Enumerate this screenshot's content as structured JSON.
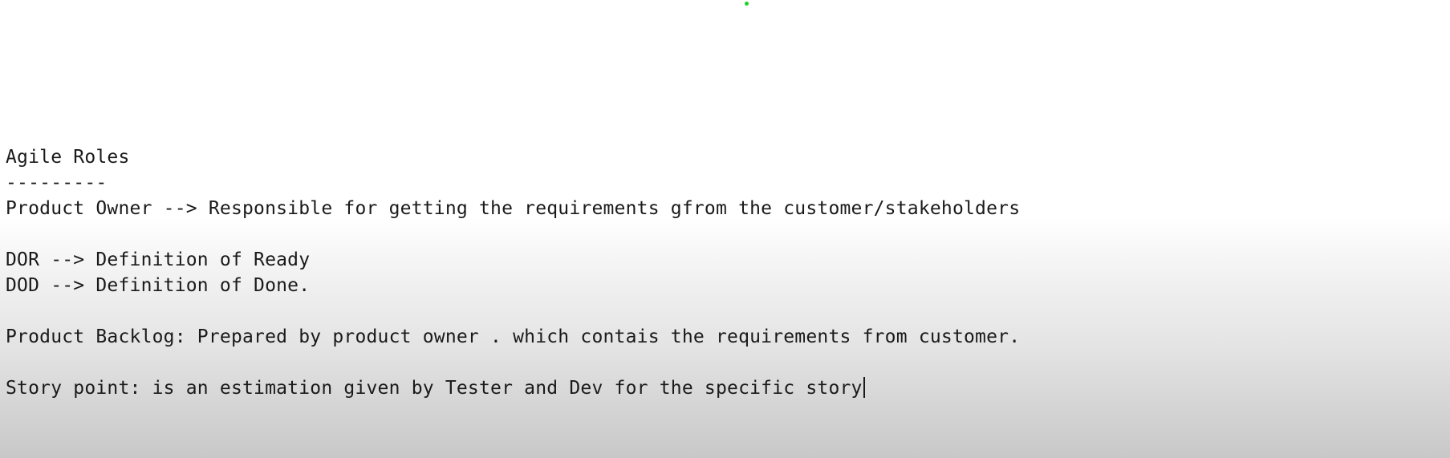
{
  "editor": {
    "lines": [
      "Agile Roles",
      "---------",
      "Product Owner --> Responsible for getting the requirements gfrom the customer/stakeholders",
      "DOR --> Definition of Ready",
      "DOD --> Definition of Done.",
      "Product Backlog: Prepared by product owner . which contais the requirements from customer.",
      "Story point: is an estimation given by Tester and Dev for the specific story"
    ]
  },
  "colors": {
    "text": "#1a1a1a",
    "cursor_dot": "#1fd11f"
  }
}
